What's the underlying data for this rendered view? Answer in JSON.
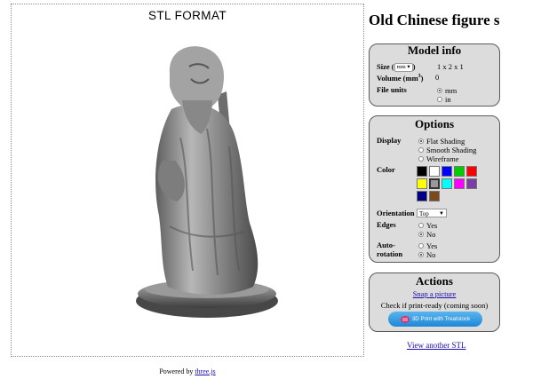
{
  "viewer": {
    "title": "STL  FORMAT"
  },
  "page_title": "Old Chinese figure s",
  "model_info": {
    "heading": "Model info",
    "size_label": "Size",
    "size_unit": "mm",
    "size_value": "1 x 2 x 1",
    "volume_label": "Volume (mm",
    "volume_sup": "3",
    "volume_close": ")",
    "volume_value": "0",
    "file_units_label": "File units",
    "units": [
      {
        "label": "mm",
        "selected": true
      },
      {
        "label": "in",
        "selected": false
      }
    ]
  },
  "options": {
    "heading": "Options",
    "display_label": "Display",
    "display": [
      {
        "label": "Flat Shading",
        "selected": true
      },
      {
        "label": "Smooth Shading",
        "selected": false
      },
      {
        "label": "Wireframe",
        "selected": false
      }
    ],
    "color_label": "Color",
    "colors": [
      "#000000",
      "#ffffff",
      "#0000ff",
      "#00cc00",
      "#ff0000",
      "#ffff00",
      "#999999",
      "#00ffff",
      "#ff00ff",
      "#7a3fa0",
      "#000080",
      "#7a4a1e"
    ],
    "selected_color_index": 6,
    "orientation_label": "Orientation",
    "orientation_value": "Top",
    "edges_label": "Edges",
    "edges": [
      {
        "label": "Yes",
        "selected": false
      },
      {
        "label": "No",
        "selected": true
      }
    ],
    "autorotation_label_1": "Auto-",
    "autorotation_label_2": "rotation",
    "autorotation": [
      {
        "label": "Yes",
        "selected": false
      },
      {
        "label": "No",
        "selected": true
      }
    ]
  },
  "actions": {
    "heading": "Actions",
    "snap_label": "Snap a picture",
    "print_ready_text": "Check if print-ready (coming soon)",
    "treatstock_label": "3D Print with Treatstock"
  },
  "view_another": "View another STL",
  "footer": {
    "powered_by": "Powered by ",
    "library": "three.js"
  }
}
